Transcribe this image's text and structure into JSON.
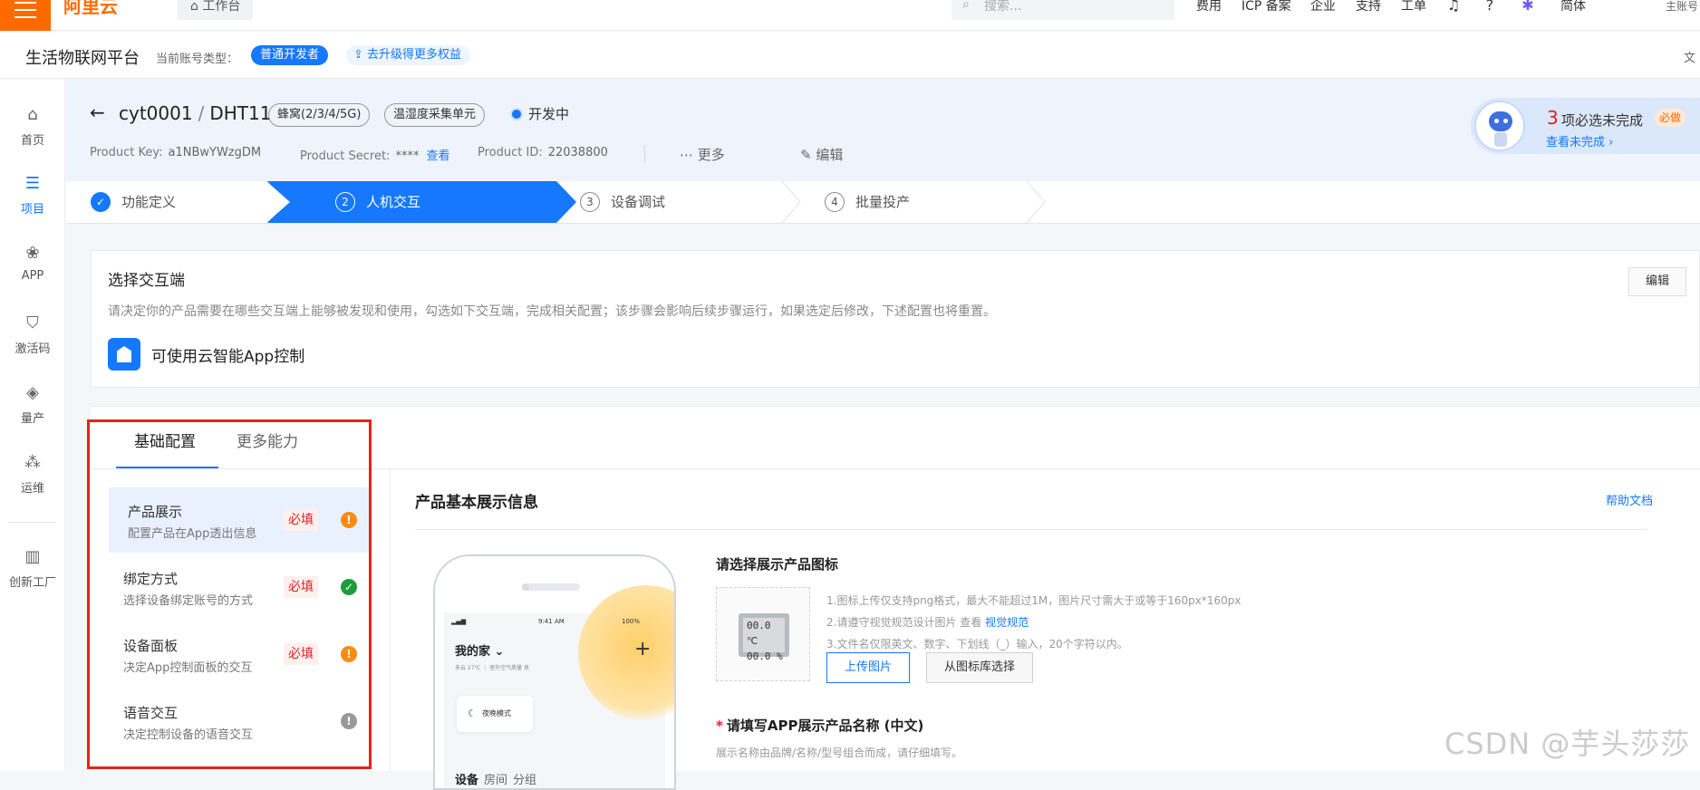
{
  "topbar": {
    "logo": "阿里云",
    "workbench": "工作台",
    "search_placeholder": "搜索...",
    "nav": [
      "费用",
      "ICP 备案",
      "企业",
      "支持",
      "工单"
    ],
    "language": "简体",
    "account_sub": "主账号"
  },
  "subbar": {
    "platform": "生活物联网平台",
    "account_type_label": "当前账号类型：",
    "developer_badge": "普通开发者",
    "upgrade": "去升级得更多权益",
    "right_text": "文"
  },
  "sidebar": {
    "items": [
      "首页",
      "项目",
      "APP",
      "激活码",
      "量产",
      "运维",
      "创新工厂"
    ]
  },
  "header": {
    "project": "cyt0001",
    "product": "DHT11",
    "tags": [
      "蜂窝(2/3/4/5G)",
      "温湿度采集单元"
    ],
    "status": "开发中",
    "product_key_label": "Product Key:",
    "product_key": "a1NBwYWzgDM",
    "product_secret_label": "Product Secret:",
    "product_secret": "****",
    "view_link": "查看",
    "product_id_label": "Product ID:",
    "product_id": "22038800",
    "more": "更多",
    "edit": "编辑"
  },
  "todo": {
    "count": "3",
    "text": "项必选未完成",
    "badge": "必做",
    "link": "查看未完成 ›"
  },
  "steps": [
    {
      "num": "✓",
      "label": "功能定义"
    },
    {
      "num": "2",
      "label": "人机交互"
    },
    {
      "num": "3",
      "label": "设备调试"
    },
    {
      "num": "4",
      "label": "批量投产"
    }
  ],
  "terminal": {
    "title": "选择交互端",
    "desc": "请决定你的产品需要在哪些交互端上能够被发现和使用，勾选如下交互端，完成相关配置；该步骤会影响后续步骤运行，如果选定后修改，下述配置也将重置。",
    "app": "可使用云智能App控制",
    "edit_btn": "编辑"
  },
  "tabs": [
    "基础配置",
    "更多能力"
  ],
  "config_items": [
    {
      "name": "产品展示",
      "sub": "配置产品在App透出信息",
      "required": "必填",
      "state": "!"
    },
    {
      "name": "绑定方式",
      "sub": "选择设备绑定账号的方式",
      "required": "必填",
      "state": "✓"
    },
    {
      "name": "设备面板",
      "sub": "决定App控制面板的交互",
      "required": "必填",
      "state": "!"
    },
    {
      "name": "语音交互",
      "sub": "决定控制设备的语音交互",
      "required": "",
      "state": "!"
    }
  ],
  "section": {
    "title": "产品基本展示信息",
    "help": "帮助文档"
  },
  "phone": {
    "time": "9:41 AM",
    "battery": "100%",
    "home": "我的家",
    "weather": "多云 27℃ ｜ 室外空气质量 良",
    "night_mode": "夜晚模式",
    "tabs": [
      "设备",
      "房间",
      "分组"
    ]
  },
  "icon_section": {
    "title": "请选择展示产品图标",
    "device_display": [
      "00.0 ℃",
      "00.0 %"
    ],
    "rule1": "1.图标上传仅支持png格式，最大不能超过1M，图片尺寸需大于或等于160px*160px",
    "rule2": "2.请遵守视觉规范设计图片 查看",
    "rule2_link": "视觉规范",
    "rule3": "3.文件名仅限英文、数字、下划线（_）输入，20个字符以内。",
    "upload_btn": "上传图片",
    "library_btn": "从图标库选择"
  },
  "name_section": {
    "star": "*",
    "title": "请填写APP展示产品名称 (中文)",
    "desc": "展示名称由品牌/名称/型号组合而成，请仔细填写。"
  },
  "watermark": "CSDN @芋头莎莎"
}
